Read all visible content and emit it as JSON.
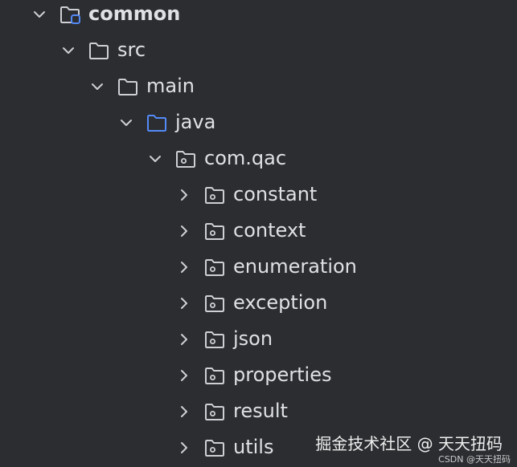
{
  "tree": {
    "items": [
      {
        "label": "common",
        "expanded": true,
        "icon": "module-folder-icon",
        "bold": true,
        "depth": 0
      },
      {
        "label": "src",
        "expanded": true,
        "icon": "folder-icon",
        "bold": false,
        "depth": 1
      },
      {
        "label": "main",
        "expanded": true,
        "icon": "folder-icon",
        "bold": false,
        "depth": 2
      },
      {
        "label": "java",
        "expanded": true,
        "icon": "source-folder-icon",
        "bold": false,
        "depth": 3
      },
      {
        "label": "com.qac",
        "expanded": true,
        "icon": "package-icon",
        "bold": false,
        "depth": 4
      },
      {
        "label": "constant",
        "expanded": false,
        "icon": "package-icon",
        "bold": false,
        "depth": 5
      },
      {
        "label": "context",
        "expanded": false,
        "icon": "package-icon",
        "bold": false,
        "depth": 5
      },
      {
        "label": "enumeration",
        "expanded": false,
        "icon": "package-icon",
        "bold": false,
        "depth": 5
      },
      {
        "label": "exception",
        "expanded": false,
        "icon": "package-icon",
        "bold": false,
        "depth": 5
      },
      {
        "label": "json",
        "expanded": false,
        "icon": "package-icon",
        "bold": false,
        "depth": 5
      },
      {
        "label": "properties",
        "expanded": false,
        "icon": "package-icon",
        "bold": false,
        "depth": 5
      },
      {
        "label": "result",
        "expanded": false,
        "icon": "package-icon",
        "bold": false,
        "depth": 5
      },
      {
        "label": "utils",
        "expanded": false,
        "icon": "package-icon",
        "bold": false,
        "depth": 5
      }
    ]
  },
  "watermark": {
    "text": "掘金技术社区 @ 天天扭码",
    "sub": "CSDN @天天扭码"
  },
  "colors": {
    "background": "#2b2d30",
    "text": "#dfe1e5",
    "icon": "#ced0d6",
    "source_folder": "#548af7",
    "module_marker": "#548af7"
  }
}
